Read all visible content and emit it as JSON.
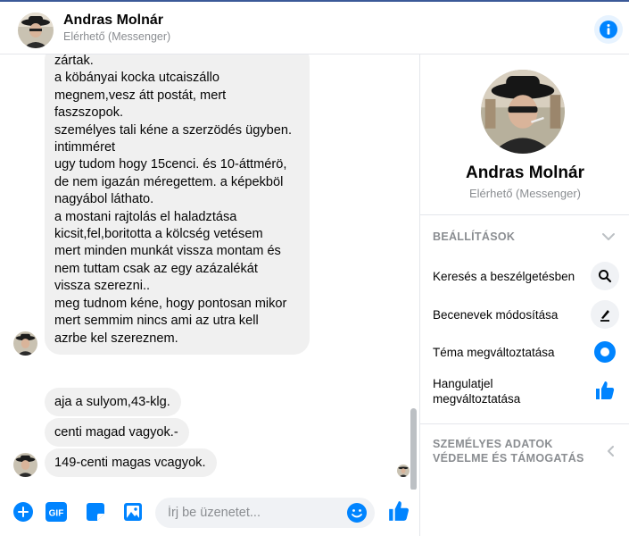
{
  "header": {
    "name": "Andras Molnár",
    "status": "Elérhető (Messenger)"
  },
  "messages": {
    "long_message_lines": [
      "zártak.",
      "a köbányai kocka utcaiszállo",
      "megnem,vesz átt postát, mert",
      "faszszopok.",
      "személyes tali kéne a szerzödés ügyben.",
      "intimméret",
      "ugy tudom hogy 15cenci. és 10-áttmérö,",
      "de nem igazán méregettem. a képekböl",
      "nagyábol láthato.",
      "a mostani rajtolás el haladztása",
      "kicsit,fel,boritotta a kölcség vetésem",
      "mert minden munkát vissza montam és",
      "nem tuttam csak az egy azázalékát",
      "vissza szerezni..",
      "meg tudnom kéne, hogy pontosan mikor",
      "mert semmim nincs ami az utra kell",
      "azrbe kel szereznem."
    ],
    "msg1": "aja a sulyom,43-klg.",
    "msg2": "centi magad vagyok.-",
    "msg3": "149-centi magas vcagyok."
  },
  "composer": {
    "placeholder": "Írj be üzenetet...",
    "gif_label": "GIF"
  },
  "panel": {
    "name": "Andras Molnár",
    "status": "Elérhető (Messenger)",
    "settings_title": "BEÁLLÍTÁSOK",
    "items": [
      {
        "label": "Keresés a beszélgetésben",
        "icon": "search-icon"
      },
      {
        "label": "Becenevek módosítása",
        "icon": "pencil-icon"
      },
      {
        "label": "Téma megváltoztatása",
        "icon": "theme-dot-icon"
      },
      {
        "label_line1": "Hangulatjel",
        "label_line2": "megváltoztatása",
        "icon": "thumbs-up-icon"
      }
    ],
    "privacy_line1": "SZEMÉLYES ADATOK",
    "privacy_line2": "VÉDELME ÉS TÁMOGATÁS"
  },
  "colors": {
    "accent": "#0084ff",
    "bubble": "#f0f0f0",
    "muted": "#8a8d91"
  }
}
